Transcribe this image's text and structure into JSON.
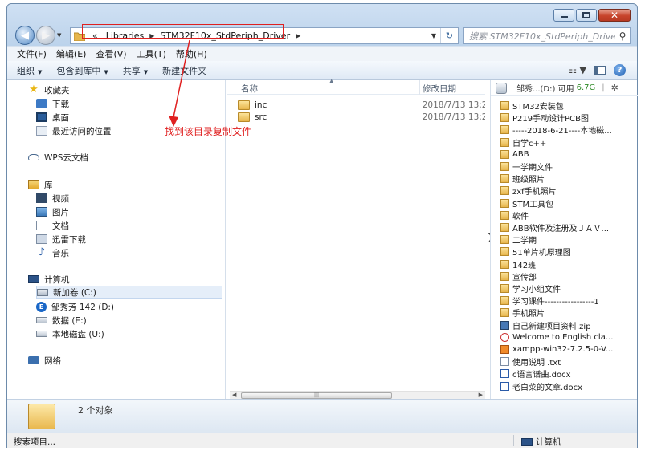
{
  "window": {
    "caption_buttons": {
      "minimize": "minimize-icon",
      "maximize": "maximize-icon",
      "close": "close-icon"
    }
  },
  "navigation": {
    "back_icon": "back-arrow-icon",
    "forward_icon": "forward-arrow-icon",
    "breadcrumb_prefix": "«",
    "breadcrumbs": [
      "Libraries",
      "STM32F10x_StdPeriph_Driver"
    ],
    "refresh_icon": "refresh-icon"
  },
  "search": {
    "placeholder": "搜索 STM32F10x_StdPeriph_Driver"
  },
  "menubar": [
    "文件(F)",
    "编辑(E)",
    "查看(V)",
    "工具(T)",
    "帮助(H)"
  ],
  "toolbar": {
    "organize": "组织",
    "include_library": "包含到库中",
    "share": "共享",
    "new_folder": "新建文件夹"
  },
  "nav_pane": {
    "favorites": {
      "label": "收藏夹",
      "items": [
        "下载",
        "桌面",
        "最近访问的位置"
      ]
    },
    "wps_cloud": "WPS云文档",
    "libraries": {
      "label": "库",
      "items": [
        "视频",
        "图片",
        "文档",
        "迅雷下载",
        "音乐"
      ]
    },
    "computer": {
      "label": "计算机",
      "items": [
        "新加卷 (C:)",
        "邹秀芳 142 (D:)",
        "数据 (E:)",
        "本地磁盘 (U:)"
      ]
    },
    "network": "网络"
  },
  "annotation": {
    "text": "找到该目录复制文件",
    "color": "#e02020"
  },
  "file_list": {
    "columns": {
      "name": "名称",
      "date": "修改日期"
    },
    "rows": [
      {
        "name": "inc",
        "date": "2018/7/13 13:2"
      },
      {
        "name": "src",
        "date": "2018/7/13 13:2"
      }
    ]
  },
  "right_pane": {
    "drive_label": "邹秀...(D:) 可用",
    "free": "6.7G",
    "items": [
      {
        "name": "STM32安装包",
        "type": "folder"
      },
      {
        "name": "P219手动设计PCB图",
        "type": "folder"
      },
      {
        "name": "-----2018-6-21----本地磁...",
        "type": "folder"
      },
      {
        "name": "自学c++",
        "type": "folder"
      },
      {
        "name": "ABB",
        "type": "folder"
      },
      {
        "name": "一学期文件",
        "type": "folder"
      },
      {
        "name": "班级照片",
        "type": "folder"
      },
      {
        "name": "zxf手机照片",
        "type": "folder"
      },
      {
        "name": "STM工具包",
        "type": "folder"
      },
      {
        "name": "软件",
        "type": "folder"
      },
      {
        "name": "ABB软件及注册及ＪＡＶ...",
        "type": "folder"
      },
      {
        "name": "二学期",
        "type": "folder"
      },
      {
        "name": "51单片机原理图",
        "type": "folder"
      },
      {
        "name": "142班",
        "type": "folder"
      },
      {
        "name": "宣传部",
        "type": "folder"
      },
      {
        "name": "学习小组文件",
        "type": "folder"
      },
      {
        "name": "学习课件-----------------1",
        "type": "folder"
      },
      {
        "name": "手机照片",
        "type": "folder"
      },
      {
        "name": "自己新建项目资料.zip",
        "type": "zip"
      },
      {
        "name": "Welcome to English cla...",
        "type": "html"
      },
      {
        "name": "xampp-win32-7.2.5-0-V...",
        "type": "exe"
      },
      {
        "name": "使用说明 .txt",
        "type": "txt"
      },
      {
        "name": "c语言谱曲.docx",
        "type": "docx"
      },
      {
        "name": "老白菜的文章.docx",
        "type": "docx"
      }
    ]
  },
  "details": {
    "count_text": "2 个对象"
  },
  "statusbar": {
    "left": "搜索项目...",
    "right": "计算机"
  }
}
